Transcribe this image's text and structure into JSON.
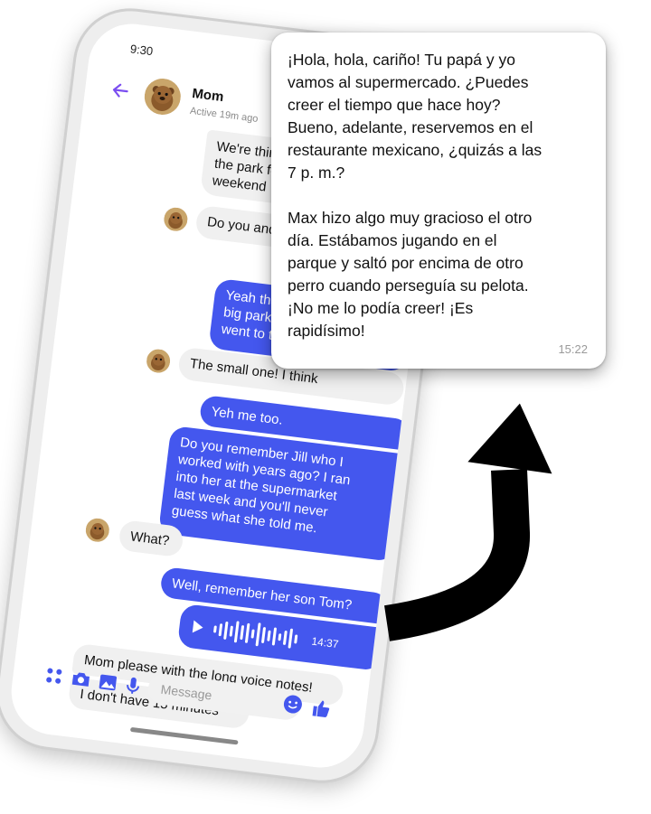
{
  "status_bar": {
    "time": "9:30"
  },
  "chat_header": {
    "contact_name": "Mom",
    "active_status": "Active 19m ago"
  },
  "messages": [
    {
      "from": "mom",
      "text": "We're thinking about\nthe park for a picnic\nweekend"
    },
    {
      "from": "mom",
      "text": "Do you and Dad want..."
    },
    {
      "from": "me",
      "text": "Yeah that sounds\nbig park or the\nwent to the other"
    },
    {
      "from": "mom",
      "text": "The small one! I think"
    },
    {
      "from": "me",
      "text": "Yeh me too."
    },
    {
      "from": "me",
      "text": "Do you remember Jill who I\nworked with years ago? I ran\ninto her at the supermarket\nlast week and you'll never\nguess what she told me."
    },
    {
      "from": "mom",
      "text": "What?"
    },
    {
      "from": "me",
      "text": "Well, remember her son Tom?"
    },
    {
      "from": "me",
      "type": "voice",
      "duration": "14:37"
    },
    {
      "from": "mom",
      "text": "Mom please with the long voice notes!"
    },
    {
      "from": "mom",
      "text": "I don't have 15 minutes"
    }
  ],
  "composer": {
    "placeholder": "Message",
    "icons": [
      "apps-icon",
      "camera-icon",
      "gallery-icon",
      "microphone-icon",
      "emoji-icon",
      "thumbs-up-icon"
    ]
  },
  "translation_popup": {
    "text": "¡Hola, hola, cariño! Tu papá y yo\nvamos al supermercado. ¿Puedes\ncreer el tiempo que hace hoy?\nBueno, adelante, reservemos en el\nrestaurante mexicano, ¿quizás a las\n7 p. m.?\n\nMax hizo algo muy gracioso el otro\ndía. Estábamos jugando en el\nparque y saltó por encima de otro\nperro cuando perseguía su pelota.\n¡No me lo podía creer! ¡Es\nrapidísimo!",
    "time": "15:22"
  },
  "colors": {
    "accent": "#4457ee",
    "back_arrow": "#7b4ef0",
    "received_bubble": "#f0f0f0",
    "arrow": "#000000"
  }
}
